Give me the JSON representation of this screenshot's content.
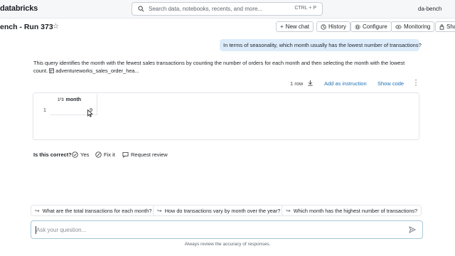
{
  "app": {
    "logo": "databricks",
    "workspace": "da-bench"
  },
  "search": {
    "placeholder": "Search data, notebooks, recents, and more...",
    "shortcut": "CTRL + P"
  },
  "page": {
    "title": "ench - Run 373"
  },
  "toolbar": {
    "new_chat": "New chat",
    "history": "History",
    "configure": "Configure",
    "monitoring": "Monitoring",
    "share": "Sha"
  },
  "chat": {
    "question": "In terms of seasonality, which month usually has the lowest number of transactions?",
    "answer_text": "This query identifies the month with the fewest sales transactions by counting the number of orders for each month and then selecting the month with the lowest count.",
    "table_ref": "adventureworks_sales_order_hea..."
  },
  "result": {
    "row_count": "1 row",
    "add_instruction": "Add as instruction",
    "show_code": "Show code",
    "columns": [
      {
        "type": "1²3",
        "name": "month"
      }
    ],
    "rows": [
      {
        "index": "1",
        "month": "9"
      }
    ]
  },
  "feedback": {
    "question": "Is this correct?",
    "yes": "Yes",
    "fix": "Fix it",
    "review": "Request review"
  },
  "suggestions": [
    "What are the total transactions for each month?",
    "How do transactions vary by month over the year?",
    "Which month has the highest number of transactions?"
  ],
  "input": {
    "placeholder": "Ask your question..."
  },
  "footer": {
    "disclaimer": "Always review the accuracy of responses."
  },
  "colors": {
    "accent": "#2272b4",
    "bubble": "#dcecfa",
    "topbar": "#f6f7f9"
  }
}
